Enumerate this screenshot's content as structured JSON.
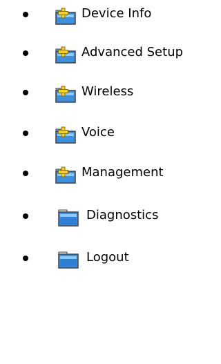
{
  "menu": {
    "items": [
      {
        "label": "Device Info",
        "icon": "folder-plus-icon"
      },
      {
        "label": "Advanced Setup",
        "icon": "folder-plus-icon"
      },
      {
        "label": "Wireless",
        "icon": "folder-plus-icon"
      },
      {
        "label": "Voice",
        "icon": "folder-plus-icon"
      },
      {
        "label": "Management",
        "icon": "folder-plus-icon"
      },
      {
        "label": "Diagnostics",
        "icon": "folder-icon"
      },
      {
        "label": "Logout",
        "icon": "folder-icon"
      }
    ]
  },
  "colors": {
    "folder_blue": "#3d8fe0",
    "folder_highlight": "#8ec9ff",
    "folder_dark": "#404040",
    "plus_yellow": "#f7d21a"
  }
}
